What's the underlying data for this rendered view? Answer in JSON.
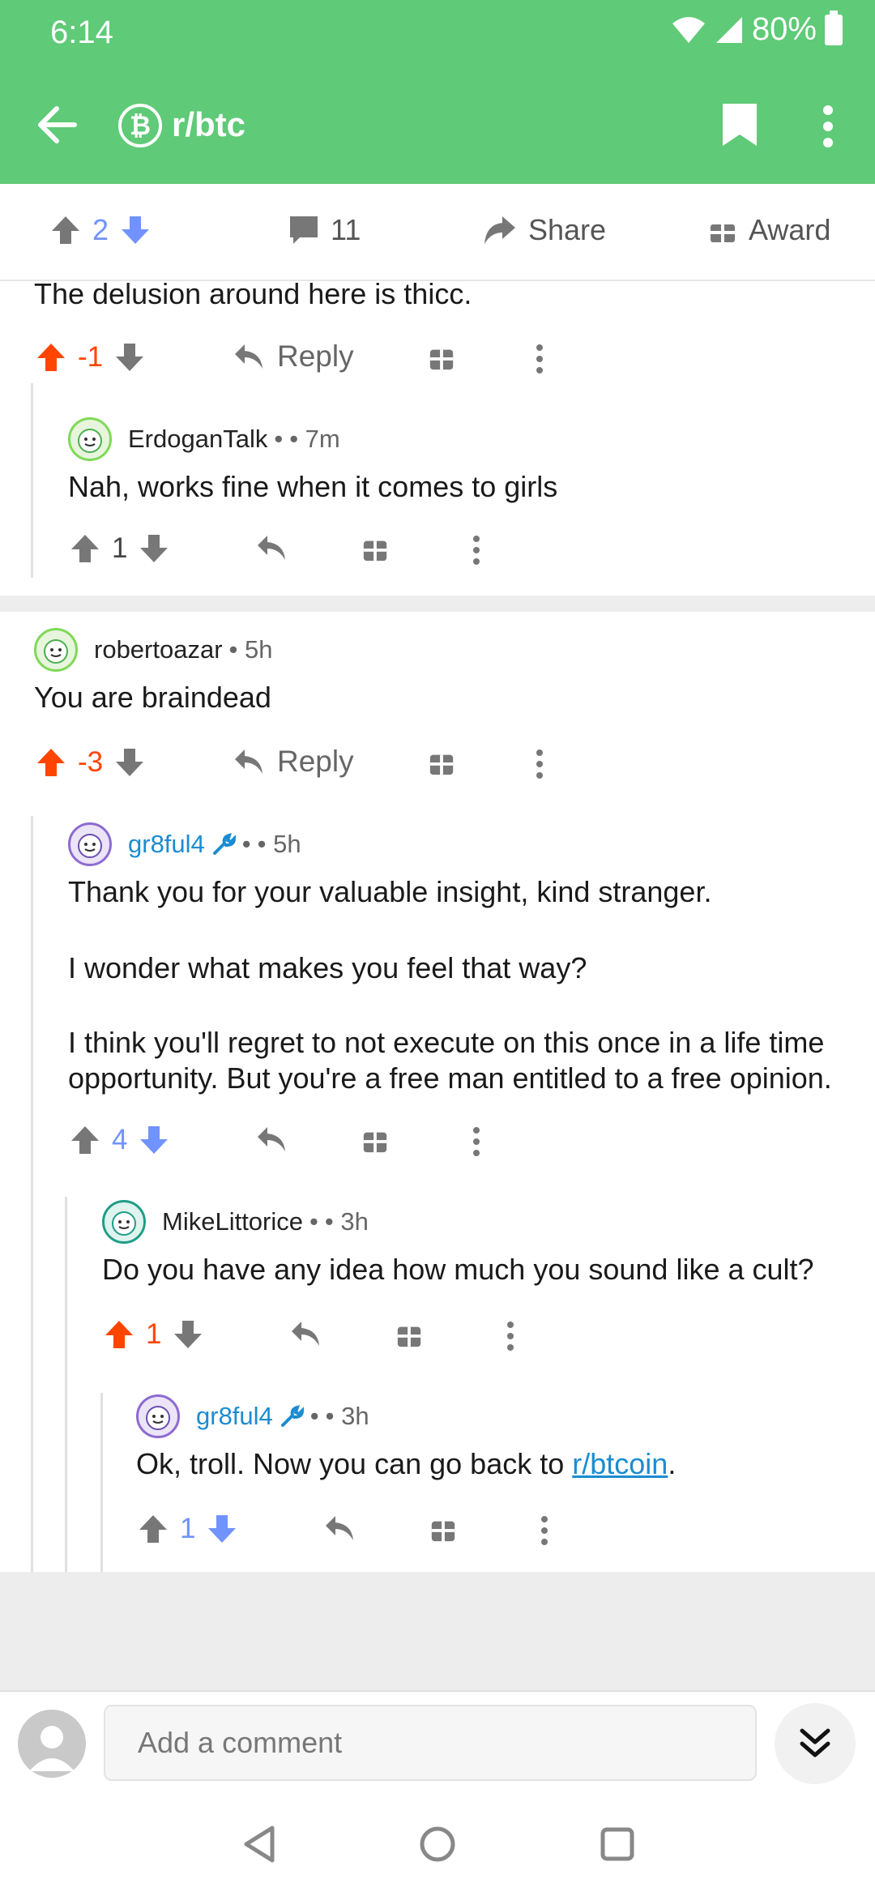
{
  "status": {
    "time": "6:14",
    "battery": "80%"
  },
  "header": {
    "subreddit": "r/btc",
    "subreddit_icon": "bitcoin-icon"
  },
  "actionbar": {
    "upvotes": "2",
    "comments": "11",
    "share_label": "Share",
    "award_label": "Award"
  },
  "colors": {
    "brand": "#5fca77",
    "upvote": "#ff4500",
    "downvote": "#7193ff",
    "link": "#1b8cd1"
  },
  "comments": {
    "c0": {
      "text": "The delusion around here is thicc.",
      "score": "-1",
      "reply_label": "Reply"
    },
    "c1": {
      "author": "ErdoganTalk",
      "bullet": "•",
      "time": "• 7m",
      "text": "Nah, works fine when it comes to girls",
      "score": "1"
    },
    "c2": {
      "author": "robertoazar",
      "time": "• 5h",
      "text": "You are braindead",
      "score": "-3",
      "reply_label": "Reply"
    },
    "c3": {
      "author": "gr8ful4",
      "bullet": "•",
      "time": "• 5h",
      "p1": "Thank you for your valuable insight, kind stranger.",
      "p2": "I wonder what makes you feel that way?",
      "p3a": "I think you'll regret to not execute on this once in a life time",
      "p3b": "opportunity. But you're a free man entitled to a free opinion.",
      "score": "4"
    },
    "c4": {
      "author": "MikeLittorice",
      "bullet": "•",
      "time": "• 3h",
      "text": "Do you have any idea how much you sound like a cult?",
      "score": "1"
    },
    "c5": {
      "author": "gr8ful4",
      "bullet": "•",
      "time": "• 3h",
      "text_before": "Ok, troll. Now you can go back to ",
      "link": "r/btcoin",
      "text_after": ".",
      "score": "1"
    }
  },
  "composer": {
    "placeholder": "Add a comment"
  }
}
